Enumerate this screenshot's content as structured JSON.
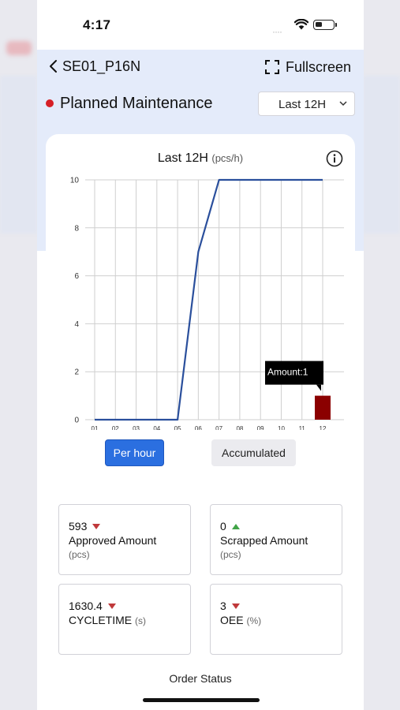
{
  "status_bar": {
    "time": "4:17",
    "signal": "····"
  },
  "nav": {
    "back_label": "SE01_P16N",
    "fullscreen_label": "Fullscreen"
  },
  "state": {
    "label": "Planned Maintenance",
    "color": "#d61f26"
  },
  "range_select": {
    "value": "Last 12H"
  },
  "chart": {
    "title": "Last 12H",
    "unit": "(pcs/h)",
    "tooltip": "Amount:1"
  },
  "chart_data": {
    "type": "line",
    "title": "Last 12H",
    "unit": "(pcs/h)",
    "categories": [
      "01",
      "02",
      "03",
      "04",
      "05",
      "06",
      "07",
      "08",
      "09",
      "10",
      "11",
      "12"
    ],
    "ylim": [
      0,
      10
    ],
    "yticks": [
      0,
      2,
      4,
      6,
      8,
      10
    ],
    "grid": true,
    "series": [
      {
        "values": [
          0,
          0,
          0,
          0,
          0,
          7,
          10,
          10,
          10,
          10,
          10,
          10
        ],
        "color": "#2a4f9c"
      }
    ],
    "bar": {
      "category": "12",
      "value": 1,
      "color": "#8b0000"
    }
  },
  "toggles": {
    "per_hour": "Per hour",
    "accumulated": "Accumulated"
  },
  "metrics": [
    {
      "value": "593",
      "trend": "down",
      "label": "Approved Amount",
      "unit": "(pcs)"
    },
    {
      "value": "0",
      "trend": "up",
      "label": "Scrapped Amount",
      "unit": "(pcs)"
    },
    {
      "value": "1630.4",
      "trend": "down",
      "label": "CYCLETIME",
      "unit": "(s)"
    },
    {
      "value": "3",
      "trend": "down",
      "label": "OEE",
      "unit": "(%)"
    }
  ],
  "order_status_label": "Order Status"
}
